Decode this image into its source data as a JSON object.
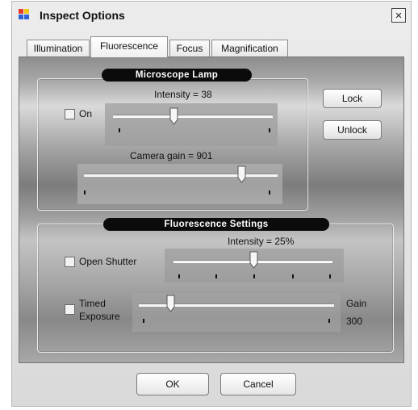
{
  "window": {
    "title": "Inspect Options",
    "close_label": "×"
  },
  "tabs": [
    {
      "label": "Illumination",
      "active": false
    },
    {
      "label": "Fluorescence",
      "active": true
    },
    {
      "label": "Focus",
      "active": false
    },
    {
      "label": "Magnification",
      "active": false
    }
  ],
  "microscope_lamp": {
    "title": "Microscope Lamp",
    "on_label": "On",
    "on_checked": false,
    "intensity_label": "Intensity = 38",
    "camera_gain_label": "Camera gain = 901",
    "lock_label": "Lock",
    "unlock_label": "Unlock"
  },
  "fluorescence_settings": {
    "title": "Fluorescence Settings",
    "intensity_label": "Intensity =  25%",
    "open_shutter_label": "Open Shutter",
    "open_shutter_checked": false,
    "timed_exposure_label_1": "Timed",
    "timed_exposure_label_2": "Exposure",
    "timed_exposure_checked": false,
    "gain_label": "Gain",
    "gain_value": "300"
  },
  "footer": {
    "ok_label": "OK",
    "cancel_label": "Cancel"
  },
  "colors": {
    "group_title_bg": "#0b0b0b",
    "app_icon": [
      "#e83a2b",
      "#f3c316",
      "#2f62d9",
      "#2f62d9"
    ]
  }
}
